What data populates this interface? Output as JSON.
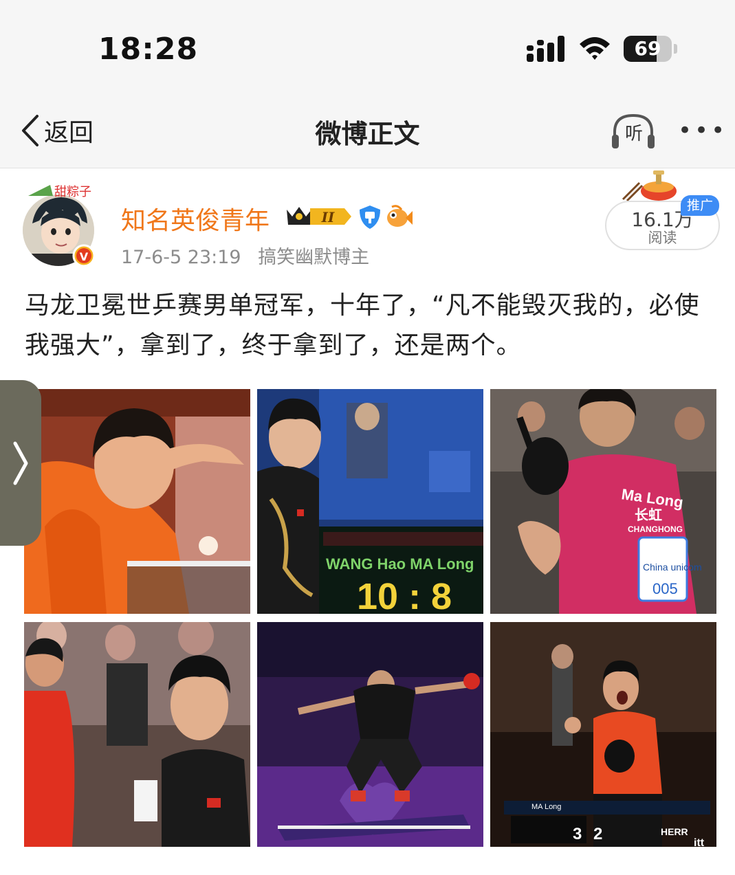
{
  "status_bar": {
    "time": "18:28",
    "battery": "69",
    "battery_level": 0.69
  },
  "nav": {
    "back_label": "返回",
    "title": "微博正文",
    "listen_label": "听",
    "more_label": "•••"
  },
  "post": {
    "username": "知名英俊青年",
    "badge_level": "II",
    "date": "17-6-5 23:19",
    "category": "搞笑幽默博主",
    "reads_count": "16.1万",
    "reads_label": "阅读",
    "ad_label": "推广",
    "text": "马龙卫冕世乒赛男单冠军，十年了，“凡不能毁灭我的，必使我强大”，拿到了，终于拿到了，还是两个。",
    "avatar_caption": "甜粽子",
    "verified_mark": "V"
  },
  "photos": {
    "p2_scoreboard_names": "WANG Hao MA Long",
    "p2_score": "10 : 8",
    "p3_jersey_name": "Ma Long",
    "p3_jersey_sponsor_cn": "长虹",
    "p3_jersey_sponsor": "CHANGHONG",
    "p3_bib_text": "China unicom",
    "p3_bib_number": "005",
    "p6_scoreboard_name": "MA Long",
    "p6_score_left": "3",
    "p6_score_right": "2",
    "p6_ad": "HERR",
    "p6_ad2": "itt"
  },
  "colors": {
    "username": "#f0771a",
    "meta": "#8c8c8c",
    "ad_tag": "#3d8cf5",
    "side_tab": "#6b6a5c"
  },
  "icons": {
    "back": "chevron-left-icon",
    "listen": "headphones-icon",
    "more": "more-dots-icon",
    "side": "chevron-right-icon"
  }
}
